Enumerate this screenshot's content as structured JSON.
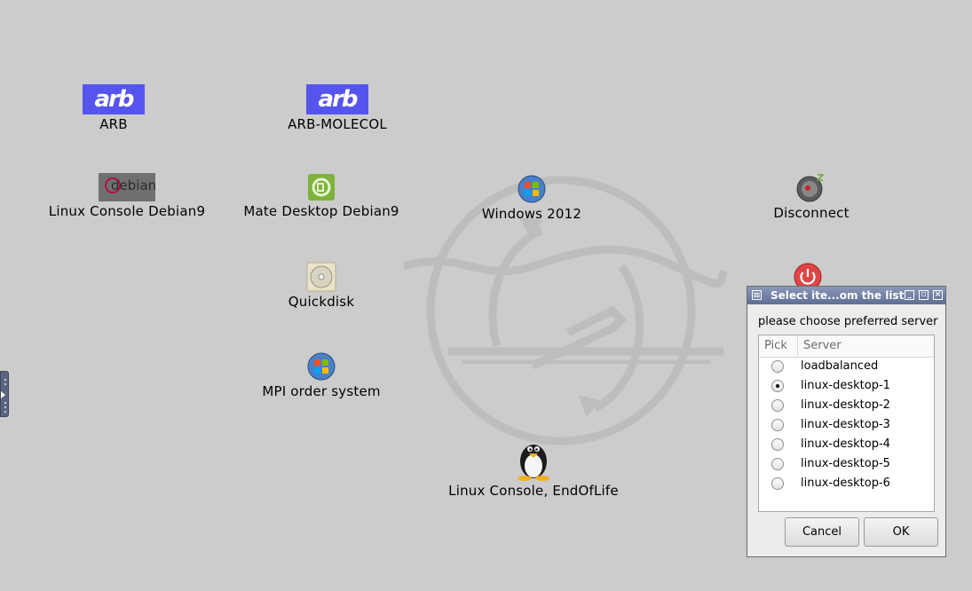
{
  "desktop": {
    "icons": [
      {
        "id": "arb",
        "label": "ARB"
      },
      {
        "id": "arb-molecol",
        "label": "ARB-MOLECOL"
      },
      {
        "id": "linux-console-debian9",
        "label": "Linux Console Debian9"
      },
      {
        "id": "mate-desktop-debian9",
        "label": "Mate Desktop Debian9"
      },
      {
        "id": "windows-2012",
        "label": "Windows 2012"
      },
      {
        "id": "disconnect",
        "label": "Disconnect"
      },
      {
        "id": "quickdisk",
        "label": "Quickdisk"
      },
      {
        "id": "mpi-order-system",
        "label": "MPI order system"
      },
      {
        "id": "linux-console-eol",
        "label": "Linux Console, EndOfLife"
      }
    ],
    "arb_logo_text": "arb",
    "debian_logo_text": "debian"
  },
  "dialog": {
    "title": "Select ite...om the list",
    "prompt": "please choose preferred server",
    "columns": {
      "pick": "Pick",
      "server": "Server"
    },
    "rows": [
      {
        "name": "loadbalanced",
        "selected": false
      },
      {
        "name": "linux-desktop-1",
        "selected": true
      },
      {
        "name": "linux-desktop-2",
        "selected": false
      },
      {
        "name": "linux-desktop-3",
        "selected": false
      },
      {
        "name": "linux-desktop-4",
        "selected": false
      },
      {
        "name": "linux-desktop-5",
        "selected": false
      },
      {
        "name": "linux-desktop-6",
        "selected": false
      }
    ],
    "cancel_label": "Cancel",
    "ok_label": "OK"
  },
  "colors": {
    "desktop_bg": "#cccccc",
    "arb_blue": "#5555ee",
    "titlebar": "#6b7aa0"
  }
}
